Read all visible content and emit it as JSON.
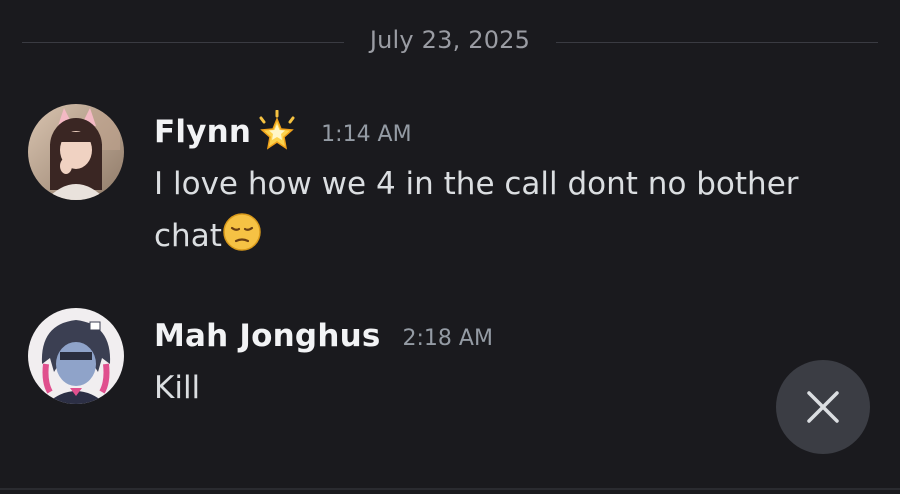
{
  "chat": {
    "date_divider": "July 23, 2025",
    "messages": [
      {
        "username": "Flynn",
        "username_badge_icon": "glowing-star-icon",
        "timestamp": "1:14 AM",
        "text": "I love how we 4 in the call dont no bother chat",
        "trailing_emoji_icon": "pensive-face-icon",
        "avatar_icon": "avatar-photo"
      },
      {
        "username": "Mah Jonghus",
        "timestamp": "2:18 AM",
        "text": "Kill",
        "avatar_icon": "avatar-anime-character"
      }
    ]
  },
  "controls": {
    "close_icon": "close-icon"
  },
  "colors": {
    "background": "#1a1a1e",
    "username": "#f2f3f5",
    "timestamp": "#949ba4",
    "message_text": "#dbdee1",
    "fab_background": "#3b3d44"
  }
}
